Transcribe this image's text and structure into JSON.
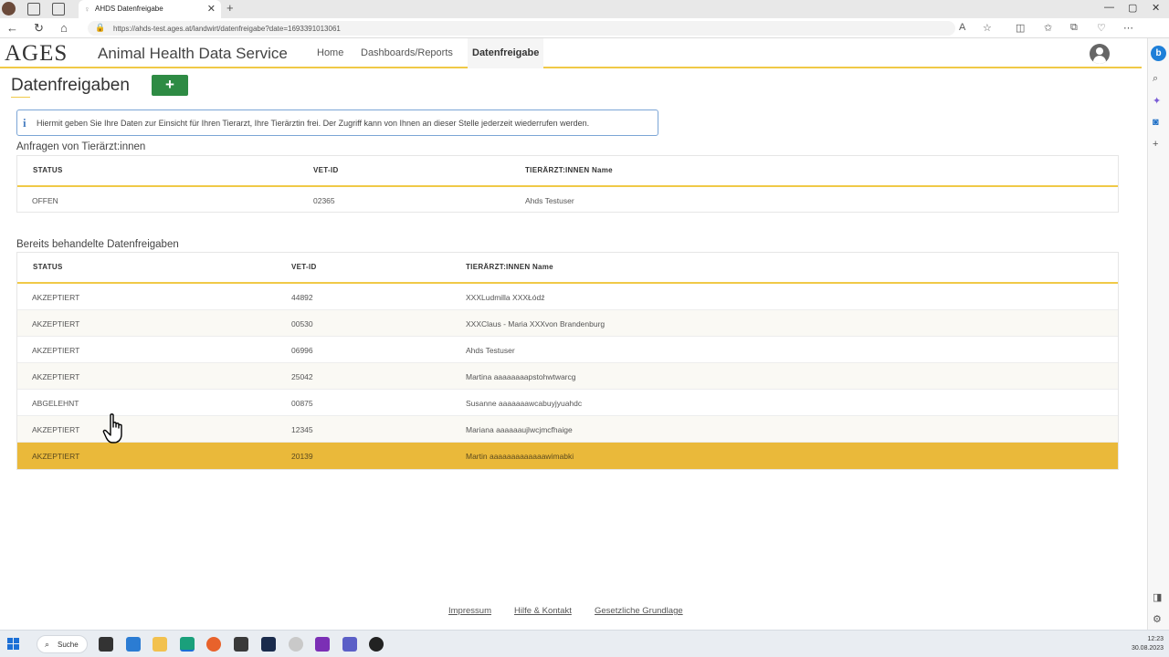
{
  "browser": {
    "tab_title": "AHDS Datenfreigabe",
    "tab_close": "✕",
    "new_tab": "+",
    "url": "https://ahds-test.ages.at/landwirt/datenfreigabe?date=1693391013061",
    "window_controls": [
      "—",
      "▢",
      "✕"
    ]
  },
  "header": {
    "logo": "AGES",
    "app_title": "Animal Health Data Service",
    "nav": [
      {
        "label": "Home"
      },
      {
        "label": "Dashboards/Reports"
      },
      {
        "label": "Datenfreigabe"
      }
    ]
  },
  "main": {
    "page_title": "Datenfreigaben",
    "add_button": "+",
    "info_text": "Hiermit geben Sie Ihre Daten zur Einsicht für Ihren Tierarzt, Ihre Tierärztin frei. Der Zugriff kann von Ihnen an dieser Stelle jederzeit wiederrufen werden.",
    "requests": {
      "title": "Anfragen von Tierärzt:innen",
      "columns": [
        "STATUS",
        "VET-ID",
        "TIERÄRZT:INNEN Name"
      ],
      "rows": [
        {
          "status": "OFFEN",
          "vet_id": "02365",
          "name": "Ahds Testuser"
        }
      ]
    },
    "processed": {
      "title": "Bereits behandelte Datenfreigaben",
      "columns": [
        "STATUS",
        "VET-ID",
        "TIERÄRZT:INNEN Name"
      ],
      "rows": [
        {
          "status": "AKZEPTIERT",
          "vet_id": "44892",
          "name": "XXXLudmilla XXXŁódź"
        },
        {
          "status": "AKZEPTIERT",
          "vet_id": "00530",
          "name": "XXXClaus - Maria XXXvon Brandenburg"
        },
        {
          "status": "AKZEPTIERT",
          "vet_id": "06996",
          "name": "Ahds Testuser"
        },
        {
          "status": "AKZEPTIERT",
          "vet_id": "25042",
          "name": "Martina aaaaaaaapstohwtwarcg"
        },
        {
          "status": "ABGELEHNT",
          "vet_id": "00875",
          "name": "Susanne aaaaaaawcabuyjyuahdc"
        },
        {
          "status": "AKZEPTIERT",
          "vet_id": "12345",
          "name": "Mariana aaaaaaujlwcjmcfhaige"
        },
        {
          "status": "AKZEPTIERT",
          "vet_id": "20139",
          "name": "Martin aaaaaaaaaaaaawimabki"
        }
      ]
    }
  },
  "footer": {
    "links": [
      "Impressum",
      "Hilfe & Kontakt",
      "Gesetzliche Grundlage"
    ]
  },
  "taskbar": {
    "search_label": "Suche",
    "time": "12:23",
    "date": "30.08.2023"
  },
  "colors": {
    "accent": "#f0c947",
    "selected_row": "#eab93a",
    "add_button": "#2e8b44",
    "info_border": "#7ba5d6"
  }
}
